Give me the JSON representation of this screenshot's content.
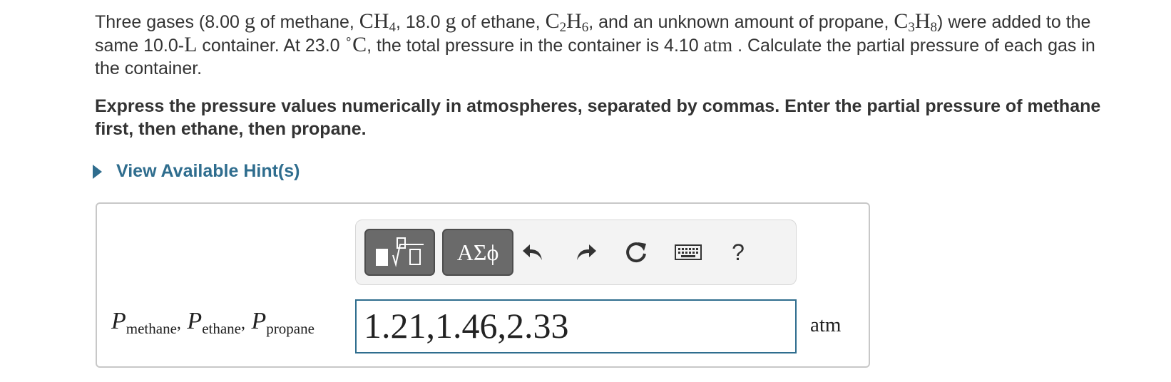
{
  "problem": {
    "p1": "Three gases (8.00 ",
    "u_g1": "g",
    "p2": " of methane, ",
    "ch4_a": "CH",
    "ch4_b": "4",
    "p3": ", 18.0 ",
    "u_g2": "g",
    "p4": " of ethane, ",
    "c2h6_a": "C",
    "c2h6_b": "2",
    "c2h6_c": "H",
    "c2h6_d": "6",
    "p5": ", and an unknown amount of propane, ",
    "c3h8_a": "C",
    "c3h8_b": "3",
    "c3h8_c": "H",
    "c3h8_d": "8",
    "p6": ") were added to the same 10.0-",
    "u_L": "L",
    "p7": " container. At 23.0 ",
    "u_deg": "∘",
    "u_C": "C",
    "p8": ", the total pressure in the container is 4.10 ",
    "u_atm": "atm",
    "p9": " . Calculate the partial pressure of each gas in the container."
  },
  "instruction": "Express the pressure values numerically in atmospheres, separated by commas. Enter the partial pressure of methane first, then ethane, then propane.",
  "hint": {
    "label": "View Available Hint(s)"
  },
  "toolbar": {
    "greek_label": "ΑΣϕ",
    "help_label": "?",
    "icons": [
      "templates-icon",
      "undo-icon",
      "redo-icon",
      "reset-icon",
      "keyboard-icon",
      "help-icon"
    ]
  },
  "answer": {
    "label_P": "P",
    "label_sub1": "methane",
    "label_sep1": ",",
    "label_sub2": "ethane",
    "label_sep2": ",",
    "label_sub3": "propane",
    "value": "1.21,1.46,2.33",
    "unit": "atm"
  },
  "colors": {
    "accent": "#2f6d8e",
    "button_dark": "#6a6a6a",
    "border": "#c8c8c8"
  }
}
